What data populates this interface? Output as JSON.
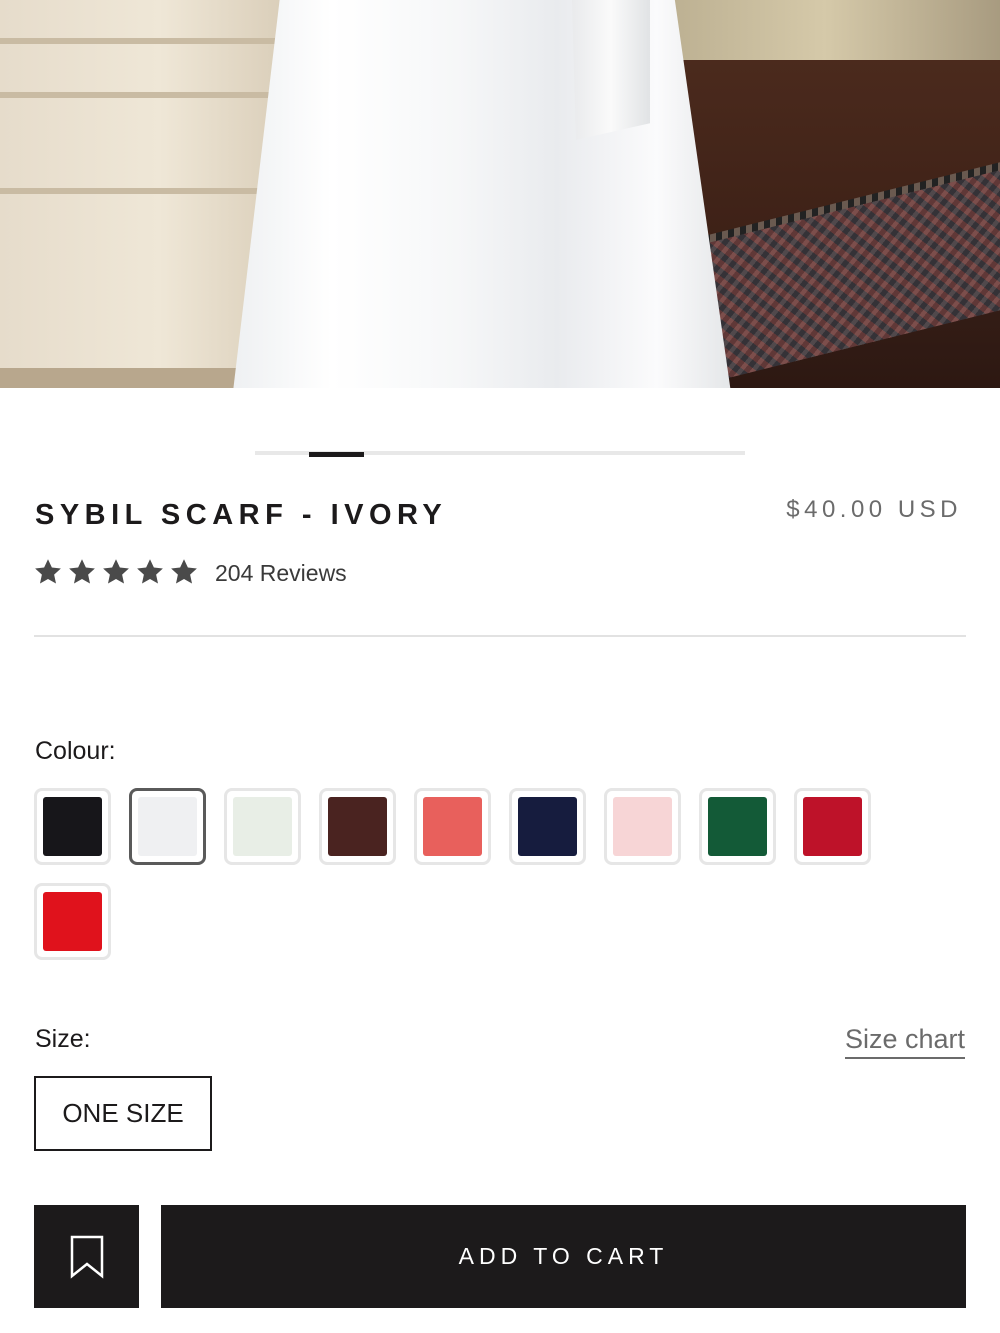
{
  "product": {
    "title": "SYBIL SCARF - IVORY",
    "price": "$40.00 USD",
    "rating": 5,
    "rating_max": 5,
    "reviews_label": "204 Reviews"
  },
  "gallery": {
    "active_slide": 1,
    "image_name": "product-photo-ivory-scarf"
  },
  "colour": {
    "label": "Colour:",
    "swatches": [
      {
        "name": "black",
        "color": "#17161a",
        "selected": false
      },
      {
        "name": "ivory",
        "color": "#eff0f2",
        "selected": true
      },
      {
        "name": "sage",
        "color": "#e8eee6",
        "selected": false
      },
      {
        "name": "chocolate",
        "color": "#4a2320",
        "selected": false
      },
      {
        "name": "coral",
        "color": "#e8605c",
        "selected": false
      },
      {
        "name": "navy",
        "color": "#161c3e",
        "selected": false
      },
      {
        "name": "blush",
        "color": "#f7d5d6",
        "selected": false
      },
      {
        "name": "emerald",
        "color": "#135a37",
        "selected": false
      },
      {
        "name": "crimson",
        "color": "#be1229",
        "selected": false
      },
      {
        "name": "red",
        "color": "#e0121c",
        "selected": false
      }
    ]
  },
  "size": {
    "label": "Size:",
    "chart_link": "Size chart",
    "options": [
      "ONE SIZE"
    ]
  },
  "actions": {
    "wishlist_icon": "bookmark-icon",
    "add_to_cart": "ADD TO CART"
  }
}
